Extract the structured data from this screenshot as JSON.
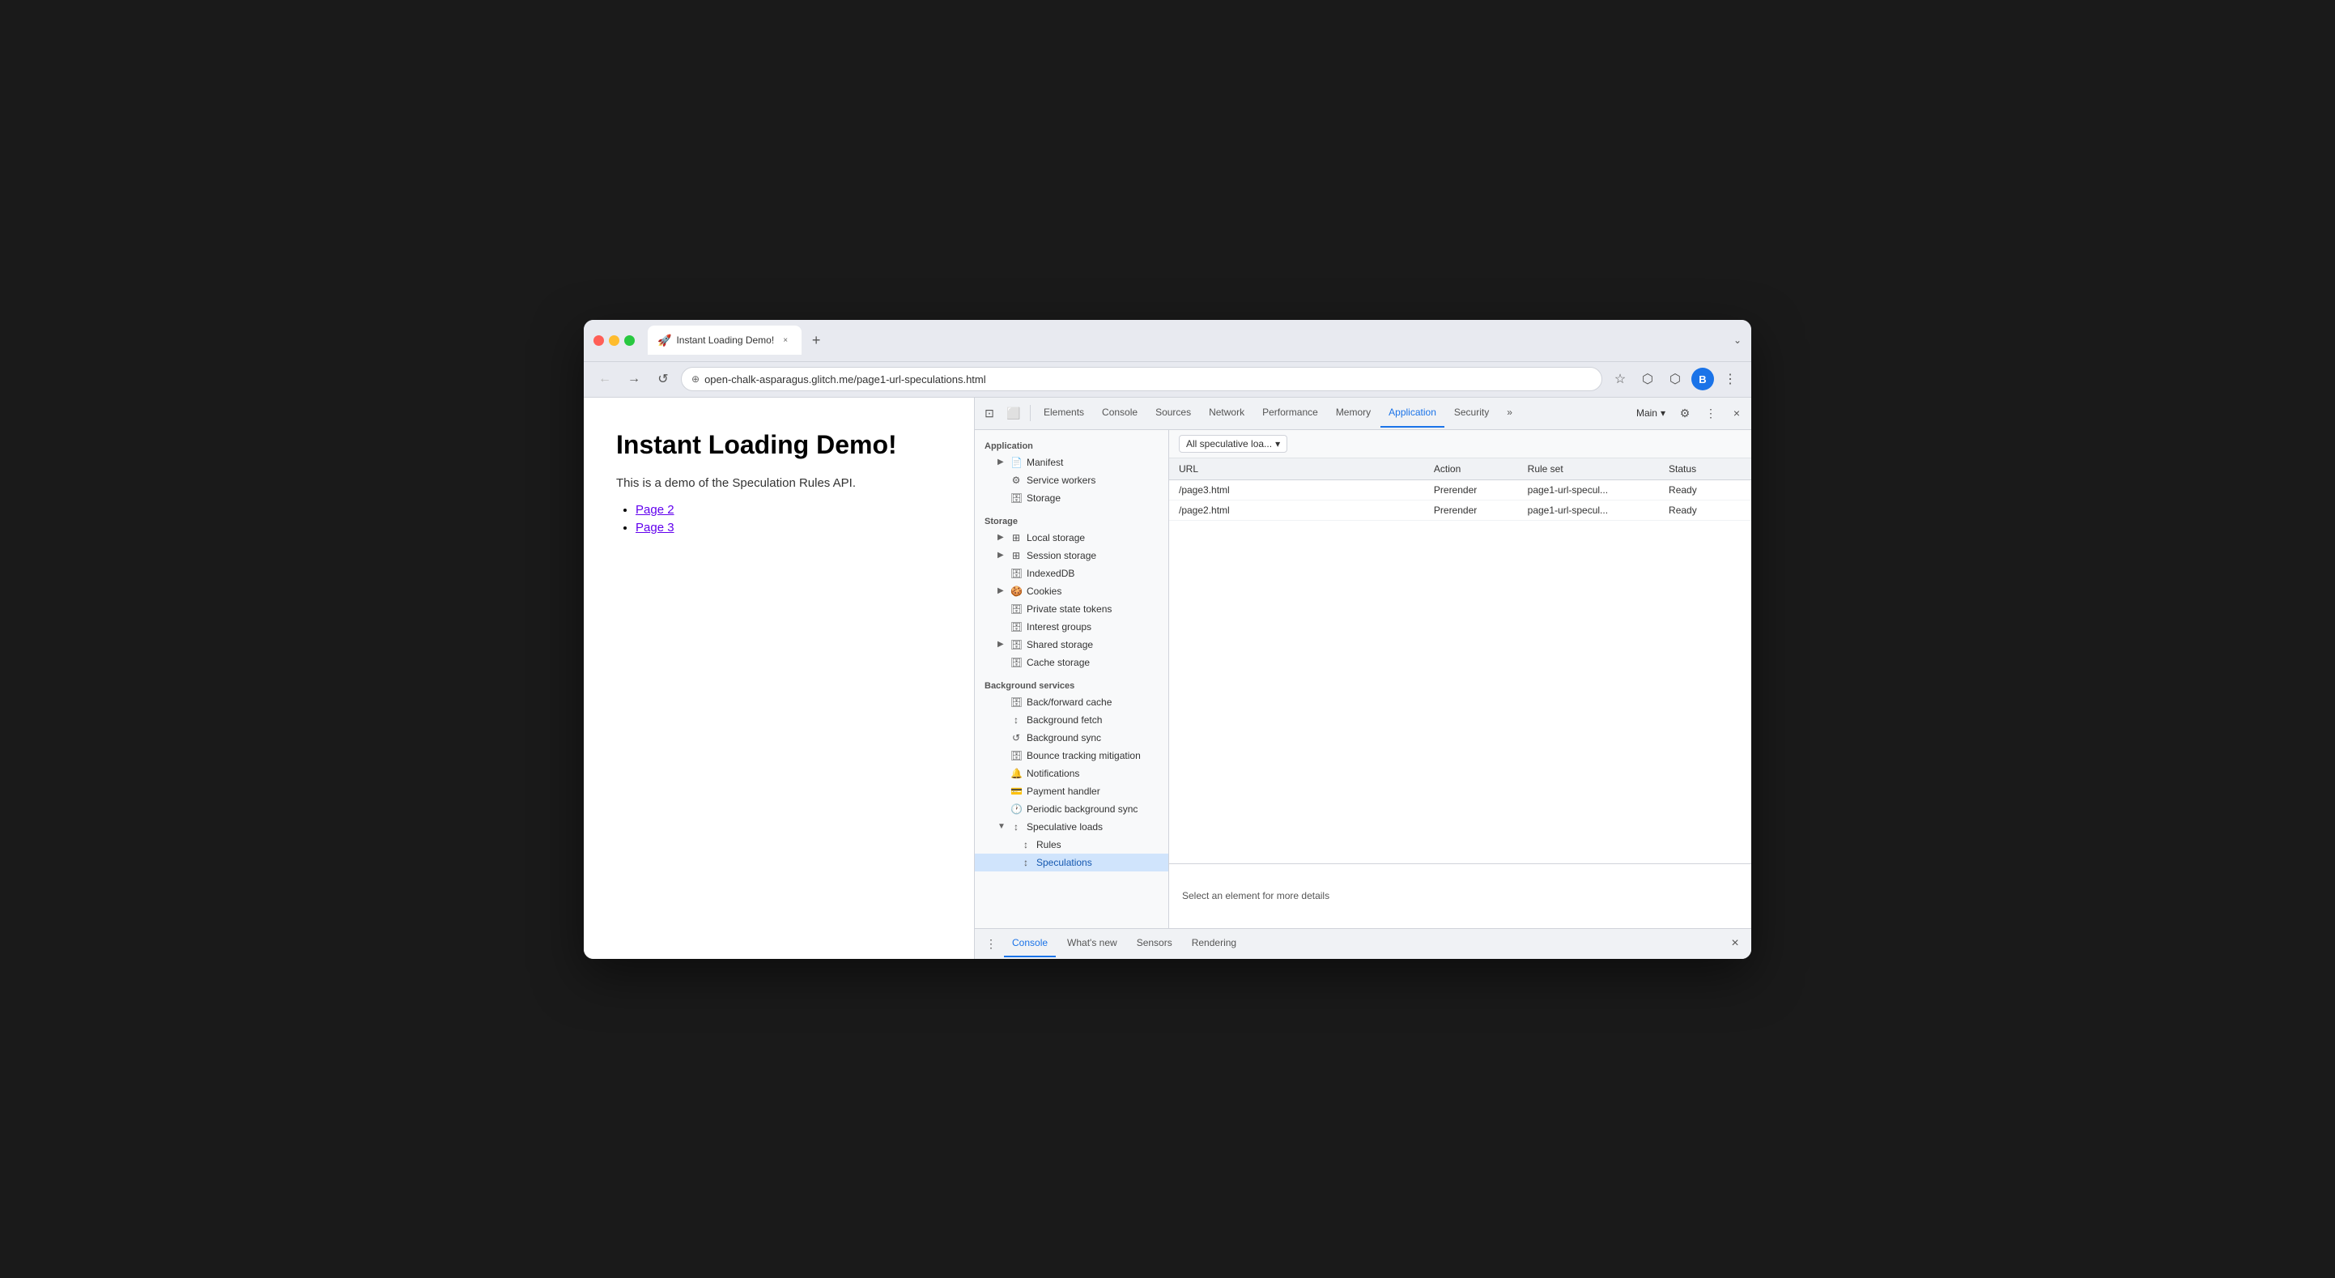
{
  "browser": {
    "traffic_lights": [
      "red",
      "yellow",
      "green"
    ],
    "tab_title": "Instant Loading Demo!",
    "tab_icon": "🚀",
    "close_icon": "×",
    "new_tab_icon": "+",
    "chevron_icon": "⌄",
    "back_icon": "←",
    "forward_icon": "→",
    "refresh_icon": "↺",
    "address_lock_icon": "⊕",
    "address_url": "open-chalk-asparagus.glitch.me/page1-url-speculations.html",
    "star_icon": "☆",
    "extension_icon": "⬡",
    "profile_icon": "⬡",
    "avatar_label": "B",
    "more_icon": "⋮"
  },
  "page": {
    "title": "Instant Loading Demo!",
    "subtitle": "This is a demo of the Speculation Rules API.",
    "links": [
      "Page 2",
      "Page 3"
    ]
  },
  "devtools": {
    "toolbar": {
      "icon1": "⊡",
      "icon2": "⬜",
      "tabs": [
        {
          "label": "Elements",
          "active": false
        },
        {
          "label": "Console",
          "active": false
        },
        {
          "label": "Sources",
          "active": false
        },
        {
          "label": "Network",
          "active": false
        },
        {
          "label": "Performance",
          "active": false
        },
        {
          "label": "Memory",
          "active": false
        },
        {
          "label": "Application",
          "active": true
        },
        {
          "label": "Security",
          "active": false
        },
        {
          "label": "»",
          "active": false
        }
      ],
      "context_label": "Main",
      "settings_icon": "⚙",
      "more_icon": "⋮",
      "close_icon": "×"
    },
    "sidebar": {
      "sections": [
        {
          "label": "Application",
          "items": [
            {
              "label": "Manifest",
              "icon": "📄",
              "indent": 1,
              "expandable": true
            },
            {
              "label": "Service workers",
              "icon": "⚙",
              "indent": 1,
              "expandable": false
            },
            {
              "label": "Storage",
              "icon": "🗄",
              "indent": 1,
              "expandable": false
            }
          ]
        },
        {
          "label": "Storage",
          "items": [
            {
              "label": "Local storage",
              "icon": "⊞",
              "indent": 1,
              "expandable": true
            },
            {
              "label": "Session storage",
              "icon": "⊞",
              "indent": 1,
              "expandable": true
            },
            {
              "label": "IndexedDB",
              "icon": "🗄",
              "indent": 1,
              "expandable": false
            },
            {
              "label": "Cookies",
              "icon": "🍪",
              "indent": 1,
              "expandable": true
            },
            {
              "label": "Private state tokens",
              "icon": "🗄",
              "indent": 1,
              "expandable": false
            },
            {
              "label": "Interest groups",
              "icon": "🗄",
              "indent": 1,
              "expandable": false
            },
            {
              "label": "Shared storage",
              "icon": "🗄",
              "indent": 1,
              "expandable": true
            },
            {
              "label": "Cache storage",
              "icon": "🗄",
              "indent": 1,
              "expandable": false
            }
          ]
        },
        {
          "label": "Background services",
          "items": [
            {
              "label": "Back/forward cache",
              "icon": "🗄",
              "indent": 1,
              "expandable": false
            },
            {
              "label": "Background fetch",
              "icon": "↕",
              "indent": 1,
              "expandable": false
            },
            {
              "label": "Background sync",
              "icon": "↺",
              "indent": 1,
              "expandable": false
            },
            {
              "label": "Bounce tracking mitigation",
              "icon": "🗄",
              "indent": 1,
              "expandable": false
            },
            {
              "label": "Notifications",
              "icon": "🔔",
              "indent": 1,
              "expandable": false
            },
            {
              "label": "Payment handler",
              "icon": "💳",
              "indent": 1,
              "expandable": false
            },
            {
              "label": "Periodic background sync",
              "icon": "🕐",
              "indent": 1,
              "expandable": false
            },
            {
              "label": "Speculative loads",
              "icon": "↕",
              "indent": 1,
              "expandable": true,
              "expanded": true
            },
            {
              "label": "Rules",
              "icon": "↕",
              "indent": 2,
              "expandable": false
            },
            {
              "label": "Speculations",
              "icon": "↕",
              "indent": 2,
              "expandable": false,
              "active": true
            }
          ]
        }
      ]
    },
    "main": {
      "filter": {
        "label": "All speculative loa...",
        "dropdown_icon": "▾"
      },
      "table": {
        "columns": [
          "URL",
          "Action",
          "Rule set",
          "Status"
        ],
        "rows": [
          {
            "url": "/page3.html",
            "action": "Prerender",
            "ruleset": "page1-url-specul...",
            "status": "Ready"
          },
          {
            "url": "/page2.html",
            "action": "Prerender",
            "ruleset": "page1-url-specul...",
            "status": "Ready"
          }
        ]
      },
      "details_text": "Select an element for more details"
    },
    "console_bar": {
      "more_icon": "⋮",
      "tabs": [
        "Console",
        "What's new",
        "Sensors",
        "Rendering"
      ],
      "active_tab": "Console",
      "close_icon": "×"
    }
  }
}
